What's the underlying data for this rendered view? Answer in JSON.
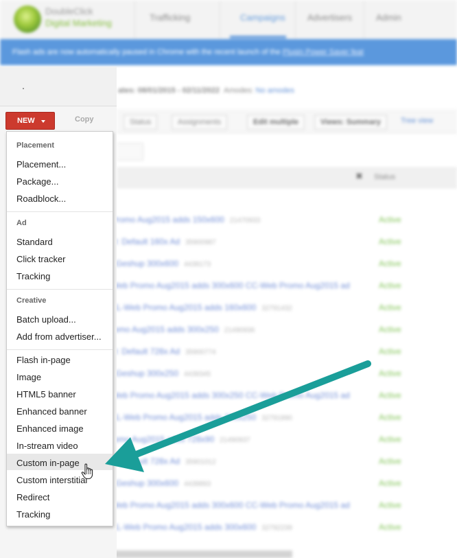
{
  "background": {
    "logo": {
      "line1": "DoubleClick",
      "line2": "Digital Marketing"
    },
    "nav": [
      "Trafficking",
      "Campaigns",
      "Advertisers",
      "Admin"
    ],
    "banner_text": "Flash ads are now automatically paused in Chrome with the recent launch of the",
    "banner_link": "Plugin Power Saver feat",
    "subline": {
      "dates": "ates: 08/01/2015 - 02/11/2022",
      "label": "Amodes:",
      "link": "No amodes"
    },
    "toolbar": [
      "Status",
      "Assignments",
      "Edit multiple",
      "Views: Summary"
    ],
    "toolbar_link": "Tree view",
    "status_header": "Status",
    "rows": [
      {
        "name": "Promo Aug2015 adds 150x600",
        "id": "21470933",
        "status": "Active"
      },
      {
        "name": "D: Default 160x Ad",
        "id": "35900987",
        "status": "Active"
      },
      {
        "name": "eGeshup 300x600",
        "id": "4439173",
        "status": "Active"
      },
      {
        "name": "Web Promo Aug2015 adds 300x600 CC-Web Promo Aug2015 ad",
        "id": "",
        "status": "Active"
      },
      {
        "name": "XL-Web Promo Aug2015 adds 160x600",
        "id": "32791432",
        "status": "Active"
      },
      {
        "name": "romo Aug2015 adds 300x250",
        "id": "21490936",
        "status": "Active"
      },
      {
        "name": "D: Default 728x Ad",
        "id": "35900774",
        "status": "Active"
      },
      {
        "name": "eGeshup 300x250",
        "id": "4439345",
        "status": "Active"
      },
      {
        "name": "Web Promo Aug2015 adds 300x250 CC-Web Promo Aug2015 ad",
        "id": "",
        "status": "Active"
      },
      {
        "name": "XL-Web Promo Aug2015 adds 300x250",
        "id": "32791890",
        "status": "Active"
      },
      {
        "name": "romo Aug2015 adds 728x90",
        "id": "21490937",
        "status": "Active"
      },
      {
        "name": "D: Default 728x Ad",
        "id": "35901012",
        "status": "Active"
      },
      {
        "name": "eGeshup 300x600",
        "id": "4439893",
        "status": "Active"
      },
      {
        "name": "Web Promo Aug2015 adds 300x600 CC-Web Promo Aug2015 ad",
        "id": "",
        "status": "Active"
      },
      {
        "name": "XL-Web Promo Aug2015 adds 300x600",
        "id": "32792239",
        "status": "Active"
      }
    ]
  },
  "controls": {
    "new_label": "NEW",
    "copy_label": "Copy"
  },
  "menu": {
    "placement_header": "Placement",
    "placement_items": [
      "Placement...",
      "Package...",
      "Roadblock..."
    ],
    "ad_header": "Ad",
    "ad_items": [
      "Standard",
      "Click tracker",
      "Tracking"
    ],
    "creative_header": "Creative",
    "creative_items": [
      "Batch upload...",
      "Add from advertiser..."
    ],
    "format_items": [
      "Flash in-page",
      "Image",
      "HTML5 banner",
      "Enhanced banner",
      "Enhanced image",
      "In-stream video",
      "Custom in-page",
      "Custom interstitial",
      "Redirect",
      "Tracking"
    ],
    "highlighted_item": "Custom in-page"
  },
  "annotation": {
    "arrow_color": "#1a9e99",
    "pointer": "hand-cursor-icon"
  },
  "colors": {
    "new_button": "#cc3a2e",
    "active_status": "#6cba3a",
    "banner": "#3f87d8"
  }
}
